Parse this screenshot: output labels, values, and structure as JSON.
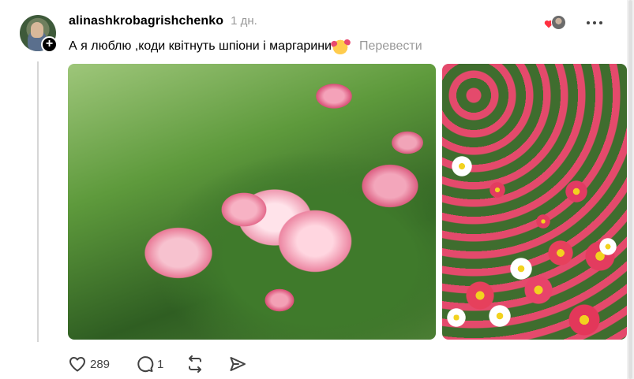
{
  "post": {
    "username": "alinashkrobagrishchenko",
    "time": "1 дн.",
    "text": "А я люблю ,коди квітнуть шпіони і маргарини",
    "translate_label": "Перевести",
    "likes": "289",
    "replies": "1"
  },
  "icons": {
    "avatar": "user-avatar",
    "follow": "plus-icon",
    "reactor_heart": "heart-icon",
    "more": "more-horizontal-icon",
    "like": "heart-outline-icon",
    "reply": "comment-icon",
    "repost": "repost-icon",
    "share": "send-icon",
    "emoji": "smiling-face-with-hearts"
  },
  "colors": {
    "text": "#000000",
    "muted": "#999999",
    "icon": "#424242",
    "heart": "#ff3040"
  }
}
